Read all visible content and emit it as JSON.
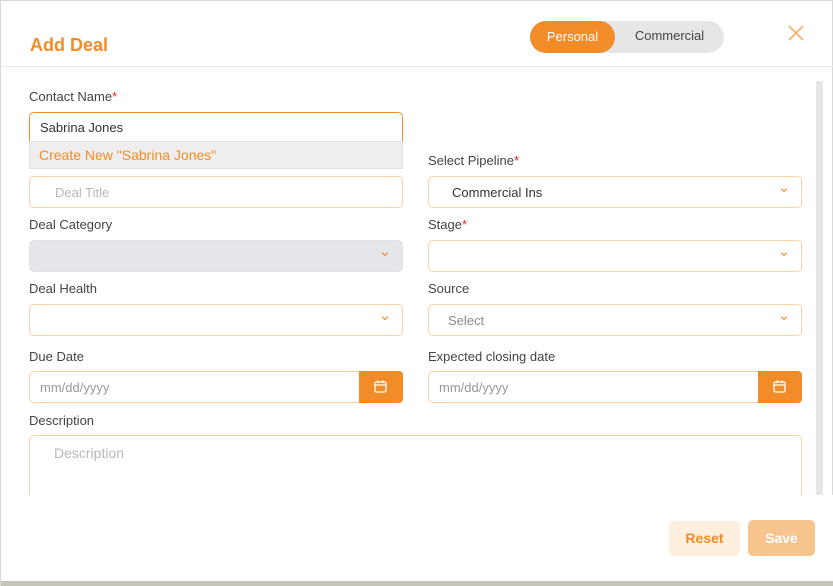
{
  "modal": {
    "title": "Add Deal",
    "toggle": {
      "personal": "Personal",
      "commercial": "Commercial",
      "selected": "Personal"
    },
    "close_icon": "close-icon"
  },
  "form": {
    "contact_name": {
      "label": "Contact Name",
      "required_mark": "*",
      "value": "Sabrina Jones",
      "suggestion": "Create New \"Sabrina Jones\""
    },
    "deal_title": {
      "placeholder": "Deal Title"
    },
    "pipeline": {
      "label": "Select Pipeline",
      "required_mark": "*",
      "value": "Commercial Ins"
    },
    "deal_category": {
      "label": "Deal Category",
      "value": ""
    },
    "stage": {
      "label": "Stage",
      "required_mark": "*",
      "value": ""
    },
    "deal_health": {
      "label": "Deal Health",
      "value": ""
    },
    "source": {
      "label": "Source",
      "value": "Select"
    },
    "due_date": {
      "label": "Due Date",
      "placeholder": "mm/dd/yyyy"
    },
    "closing_date": {
      "label": "Expected closing date",
      "placeholder": "mm/dd/yyyy"
    },
    "description": {
      "label": "Description",
      "placeholder": "Description"
    }
  },
  "footer": {
    "reset_label": "Reset",
    "save_label": "Save"
  },
  "colors": {
    "accent": "#f28c28",
    "required": "#e02424"
  }
}
